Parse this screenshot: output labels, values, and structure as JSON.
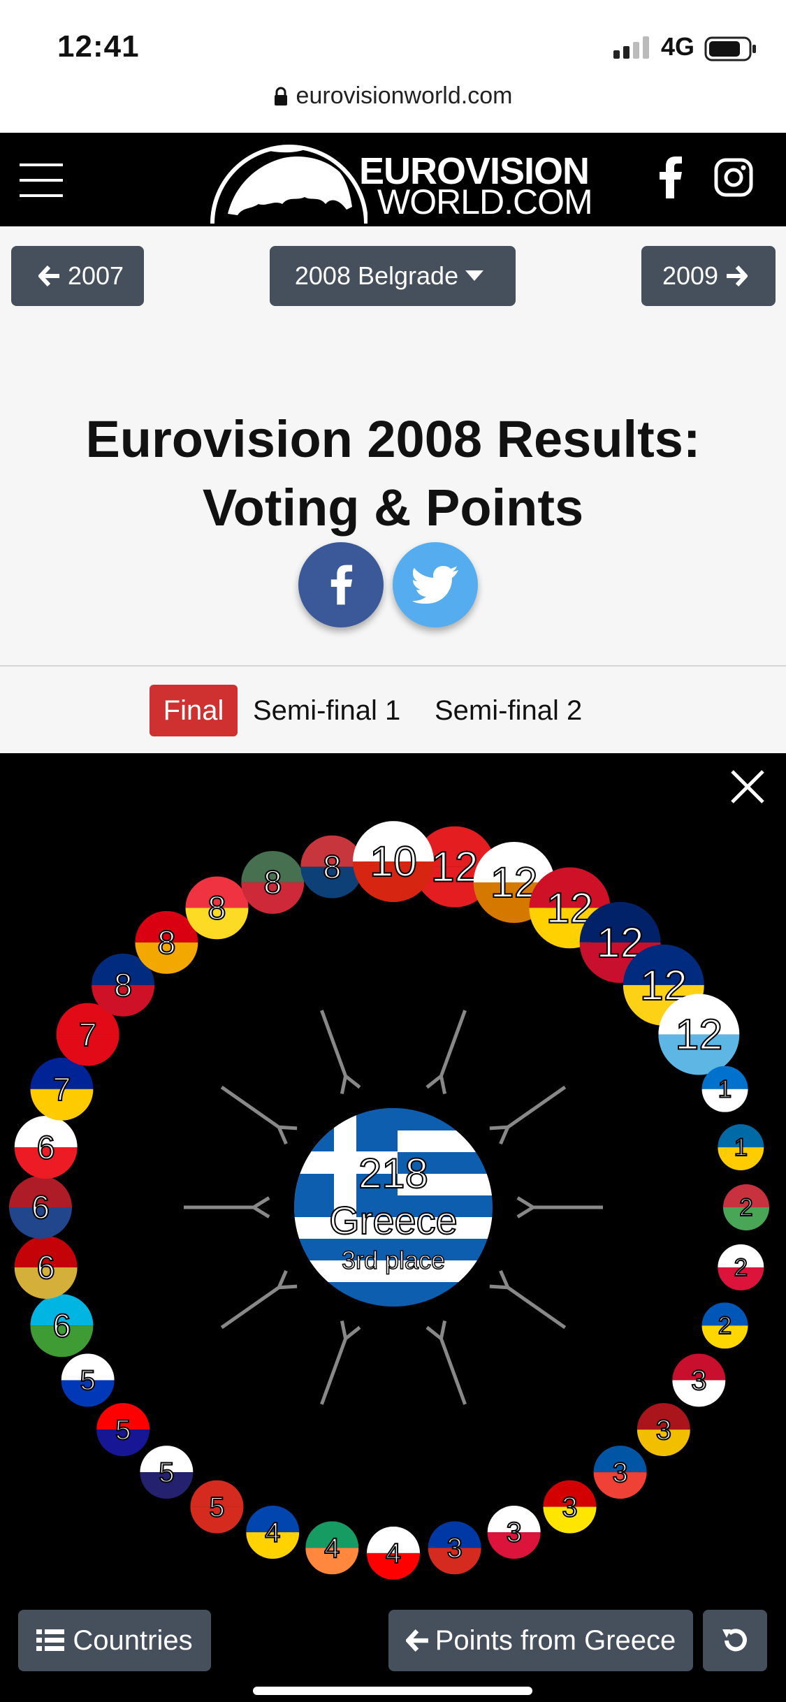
{
  "status_bar": {
    "time": "12:41",
    "network": "4G",
    "url": "eurovisionworld.com"
  },
  "header": {
    "logo_line1": "EUROVISION",
    "logo_line2": "WORLD.COM"
  },
  "year_nav": {
    "prev": "2007",
    "current": "2008 Belgrade",
    "next": "2009"
  },
  "title": "Eurovision 2008 Results: Voting & Points",
  "tabs": {
    "final": "Final",
    "semi1": "Semi-final 1",
    "semi2": "Semi-final 2"
  },
  "center": {
    "points": "218",
    "country": "Greece",
    "place": "3rd place"
  },
  "bottom": {
    "countries": "Countries",
    "points_from": "Points from Greece"
  },
  "voters": [
    {
      "pts": "12",
      "colors": [
        "#e41e20",
        "#e41e20"
      ]
    },
    {
      "pts": "12",
      "colors": [
        "#ffffff",
        "#d57800"
      ]
    },
    {
      "pts": "12",
      "colors": [
        "#ce1126",
        "#ffd100"
      ]
    },
    {
      "pts": "12",
      "colors": [
        "#012169",
        "#c8102e"
      ]
    },
    {
      "pts": "12",
      "colors": [
        "#002b7f",
        "#fcd116"
      ]
    },
    {
      "pts": "12",
      "colors": [
        "#ffffff",
        "#5eb6e4"
      ]
    },
    {
      "pts": "1",
      "colors": [
        "#0072ce",
        "#ffffff"
      ]
    },
    {
      "pts": "1",
      "colors": [
        "#006aa7",
        "#fecc00"
      ]
    },
    {
      "pts": "2",
      "colors": [
        "#c8313e",
        "#4aa657"
      ]
    },
    {
      "pts": "2",
      "colors": [
        "#ffffff",
        "#dc143c"
      ]
    },
    {
      "pts": "2",
      "colors": [
        "#0057b7",
        "#ffd700"
      ]
    },
    {
      "pts": "3",
      "colors": [
        "#c8102e",
        "#ffffff"
      ]
    },
    {
      "pts": "3",
      "colors": [
        "#aa151b",
        "#f1bf00"
      ]
    },
    {
      "pts": "3",
      "colors": [
        "#0055a4",
        "#ef4135"
      ]
    },
    {
      "pts": "3",
      "colors": [
        "#d20000",
        "#ffe600"
      ]
    },
    {
      "pts": "3",
      "colors": [
        "#ffffff",
        "#dc143c"
      ]
    },
    {
      "pts": "3",
      "colors": [
        "#0039a6",
        "#d52b1e"
      ]
    },
    {
      "pts": "4",
      "colors": [
        "#ffffff",
        "#ff0000"
      ]
    },
    {
      "pts": "4",
      "colors": [
        "#169b62",
        "#ff883e"
      ]
    },
    {
      "pts": "4",
      "colors": [
        "#0046ae",
        "#ffd200"
      ]
    },
    {
      "pts": "5",
      "colors": [
        "#d52b1e",
        "#d52b1e"
      ]
    },
    {
      "pts": "5",
      "colors": [
        "#ffffff",
        "#24216f"
      ]
    },
    {
      "pts": "5",
      "colors": [
        "#ff0000",
        "#171796"
      ]
    },
    {
      "pts": "5",
      "colors": [
        "#ffffff",
        "#0038b8"
      ]
    },
    {
      "pts": "6",
      "colors": [
        "#00b5e2",
        "#3f9c35"
      ]
    },
    {
      "pts": "6",
      "colors": [
        "#c40308",
        "#d4af3a"
      ]
    },
    {
      "pts": "6",
      "colors": [
        "#ae1c28",
        "#21468b"
      ]
    },
    {
      "pts": "6",
      "colors": [
        "#ffffff",
        "#ed1c24"
      ]
    },
    {
      "pts": "7",
      "colors": [
        "#002395",
        "#fecb00"
      ]
    },
    {
      "pts": "7",
      "colors": [
        "#e30a17",
        "#e30a17"
      ]
    },
    {
      "pts": "8",
      "colors": [
        "#002b7f",
        "#ce1126"
      ]
    },
    {
      "pts": "8",
      "colors": [
        "#d90012",
        "#f2a800"
      ]
    },
    {
      "pts": "8",
      "colors": [
        "#ef3340",
        "#fdda24"
      ]
    },
    {
      "pts": "8",
      "colors": [
        "#477050",
        "#ce2939"
      ]
    },
    {
      "pts": "8",
      "colors": [
        "#c6363c",
        "#0c4076"
      ]
    },
    {
      "pts": "10",
      "colors": [
        "#ffffff",
        "#d62612"
      ]
    }
  ]
}
